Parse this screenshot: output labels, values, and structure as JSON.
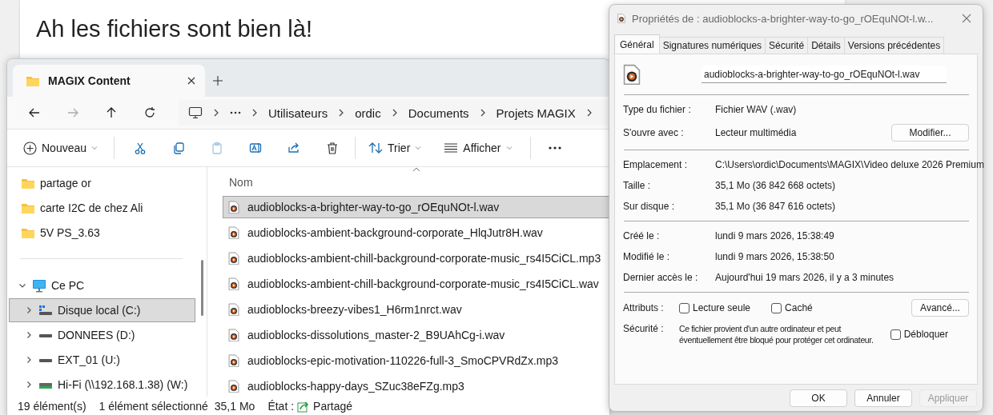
{
  "page": {
    "lines": [
      {
        "text": "Ah les fichiers sont bien là!"
      }
    ]
  },
  "explorer": {
    "tabs": [
      {
        "label": "MAGIX Content",
        "selected": true
      }
    ],
    "nav_buttons": [
      {
        "kind": "back",
        "disabled": false
      },
      {
        "kind": "forward",
        "disabled": true
      },
      {
        "kind": "up",
        "disabled": false
      },
      {
        "kind": "refresh",
        "disabled": false
      }
    ],
    "breadcrumb": [
      "Utilisateurs",
      "ordic",
      "Documents",
      "Projets MAGIX"
    ],
    "toolbar": {
      "new_label": "Nouveau",
      "actions": [
        {
          "kind": "cut",
          "disabled": false
        },
        {
          "kind": "copy",
          "disabled": false
        },
        {
          "kind": "paste",
          "disabled": true
        },
        {
          "kind": "rename",
          "disabled": false
        },
        {
          "kind": "share",
          "disabled": false
        },
        {
          "kind": "delete",
          "disabled": false
        }
      ],
      "sort_label": "Trier",
      "view_label": "Afficher"
    },
    "nav": [
      {
        "kind": "folder",
        "label": "partage or",
        "selected": false
      },
      {
        "kind": "folder",
        "label": "carte I2C de chez Ali",
        "selected": false
      },
      {
        "kind": "folder",
        "label": "5V PS_3.63",
        "selected": false
      },
      {
        "kind": "pc",
        "label": "Ce PC",
        "selected": false,
        "expanded": true,
        "children": [
          {
            "kind": "system-drive",
            "label": "Disque local (C:)",
            "selected": true,
            "expanded": false
          },
          {
            "kind": "drive",
            "label": "DONNEES (D:)",
            "selected": false,
            "expanded": false
          },
          {
            "kind": "drive",
            "label": "EXT_01 (U:)",
            "selected": false,
            "expanded": false
          },
          {
            "kind": "network-drive",
            "label": "Hi-Fi (\\\\192.168.1.38) (W:)",
            "selected": false,
            "expanded": false
          }
        ]
      }
    ],
    "column": "Nom",
    "files": [
      {
        "name": "audioblocks-a-brighter-way-to-go_rOEquNOt-l.wav",
        "selected": true
      },
      {
        "name": "audioblocks-ambient-background-corporate_HlqJutr8H.wav",
        "selected": false
      },
      {
        "name": "audioblocks-ambient-chill-background-corporate-music_rs4I5CiCL.mp3",
        "selected": false
      },
      {
        "name": "audioblocks-ambient-chill-background-corporate-music_rs4I5CiCL.wav",
        "selected": false
      },
      {
        "name": "audioblocks-breezy-vibes1_H6rm1nrct.wav",
        "selected": false
      },
      {
        "name": "audioblocks-dissolutions_master-2_B9UAhCg-i.wav",
        "selected": false
      },
      {
        "name": "audioblocks-epic-motivation-110226-full-3_SmoCPVRdZx.mp3",
        "selected": false
      },
      {
        "name": "audioblocks-happy-days_SZuc38eFZg.mp3",
        "selected": false
      }
    ],
    "status": {
      "count": "19 élément(s)",
      "selection": "1 élément sélectionné",
      "size": "35,1 Mo",
      "state_label": "État :",
      "state": "Partagé"
    }
  },
  "dialog": {
    "title": "Propriétés de : audioblocks-a-brighter-way-to-go_rOEquNOt-l.w...",
    "tabs": [
      {
        "label": "Général",
        "selected": true
      },
      {
        "label": "Signatures numériques",
        "selected": false
      },
      {
        "label": "Sécurité",
        "selected": false
      },
      {
        "label": "Détails",
        "selected": false
      },
      {
        "label": "Versions précédentes",
        "selected": false
      }
    ],
    "file_name": "audioblocks-a-brighter-way-to-go_rOEquNOt-l.wav",
    "groups": [
      [
        {
          "label": "Type du fichier :",
          "value": "Fichier WAV (.wav)"
        },
        {
          "label": "S'ouvre avec :",
          "value": "Lecteur multimédia",
          "button": "Modifier..."
        }
      ],
      [
        {
          "label": "Emplacement :",
          "value": "C:\\Users\\ordic\\Documents\\MAGIX\\Video deluxe 2026 Premium"
        },
        {
          "label": "Taille :",
          "value": "35,1 Mo (36 842 668 octets)"
        },
        {
          "label": "Sur disque :",
          "value": "35,1 Mo (36 847 616 octets)"
        }
      ],
      [
        {
          "label": "Créé le :",
          "value": "lundi 9 mars 2026, 15:38:49"
        },
        {
          "label": "Modifié le :",
          "value": "lundi 9 mars 2026, 15:38:50"
        },
        {
          "label": "Dernier accès le :",
          "value": "Aujourd'hui 19 mars 2026, il y a 3 minutes"
        }
      ]
    ],
    "attributes": {
      "label": "Attributs :",
      "checks": [
        {
          "label": "Lecture seule",
          "checked": false
        },
        {
          "label": "Caché",
          "checked": false
        }
      ],
      "button": "Avancé..."
    },
    "security": {
      "label": "Sécurité :",
      "text": "Ce fichier provient d'un autre ordinateur et peut éventuellement être bloqué pour protéger cet ordinateur.",
      "check": {
        "label": "Débloquer",
        "checked": false
      }
    },
    "buttons": [
      {
        "label": "OK",
        "disabled": false
      },
      {
        "label": "Annuler",
        "disabled": false
      },
      {
        "label": "Appliquer",
        "disabled": true
      }
    ]
  }
}
